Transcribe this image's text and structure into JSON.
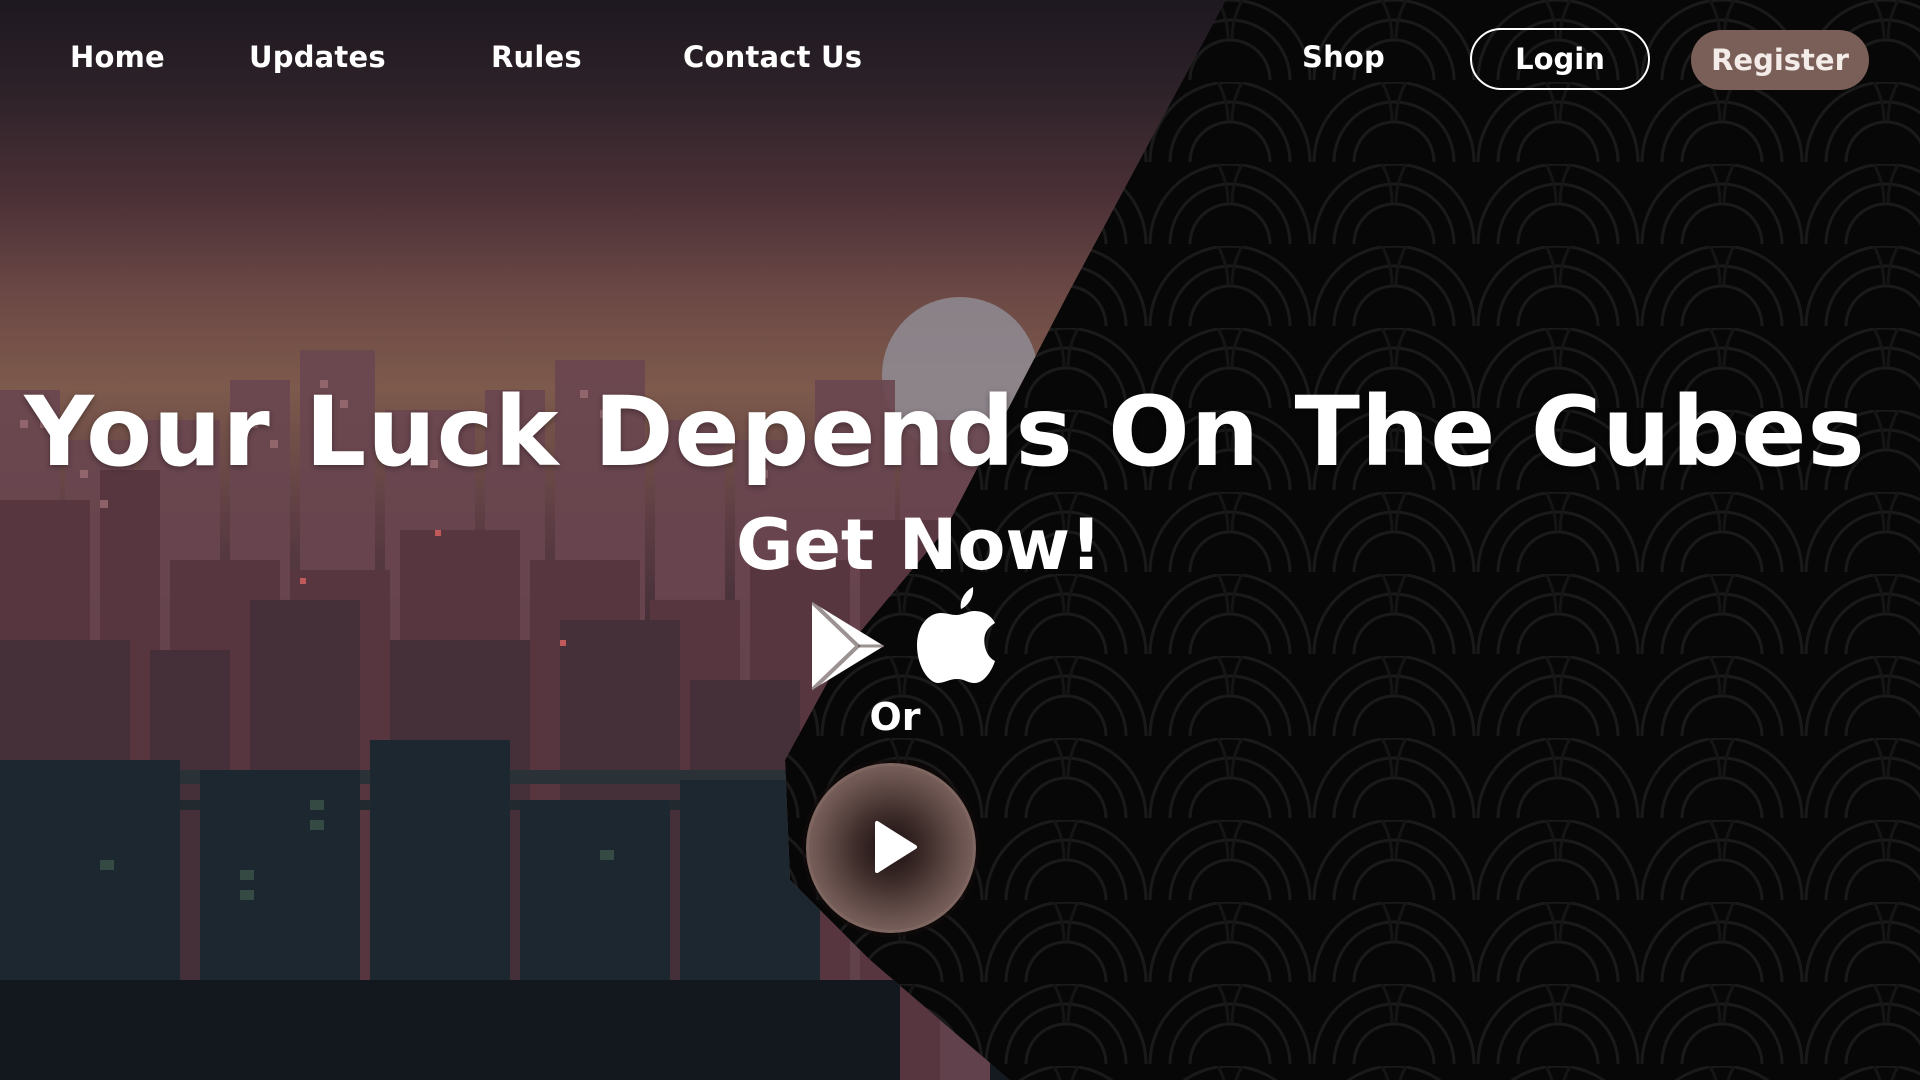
{
  "nav": {
    "home": "Home",
    "updates": "Updates",
    "rules": "Rules",
    "contact": "Contact Us",
    "shop": "Shop",
    "login": "Login",
    "register": "Register"
  },
  "hero": {
    "title": "Your Luck Depends On The Cubes",
    "subtitle": "Get Now!",
    "or": "Or"
  },
  "icons": {
    "google_play": "google-play-icon",
    "apple": "apple-icon",
    "play": "play-icon"
  },
  "colors": {
    "register_bg": "#7a5f58",
    "play_ring": "#7f6660",
    "dark_bg": "#070707"
  }
}
